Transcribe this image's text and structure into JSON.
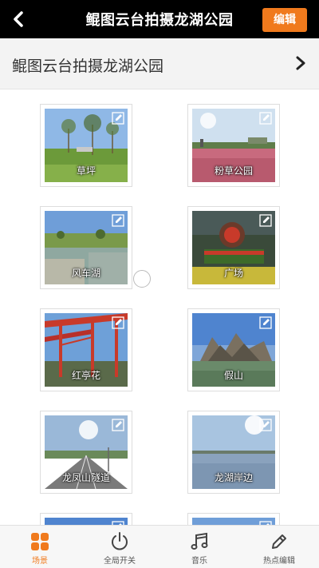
{
  "header": {
    "title": "鲲图云台拍摄龙湖公园",
    "edit_label": "编辑"
  },
  "subheader": {
    "title": "鲲图云台拍摄龙湖公园"
  },
  "scenes": [
    {
      "label": "草坪"
    },
    {
      "label": "粉草公园"
    },
    {
      "label": "风车湖"
    },
    {
      "label": "广场"
    },
    {
      "label": "红亭花"
    },
    {
      "label": "假山"
    },
    {
      "label": "龙凤山隧道"
    },
    {
      "label": "龙湖岸边"
    }
  ],
  "tabs": [
    {
      "label": "场景",
      "icon": "grid-icon",
      "active": true
    },
    {
      "label": "全局开关",
      "icon": "power-icon",
      "active": false
    },
    {
      "label": "音乐",
      "icon": "music-icon",
      "active": false
    },
    {
      "label": "热点编辑",
      "icon": "pencil-icon",
      "active": false
    }
  ],
  "colors": {
    "accent": "#f07a1d",
    "topbar": "#000000"
  }
}
